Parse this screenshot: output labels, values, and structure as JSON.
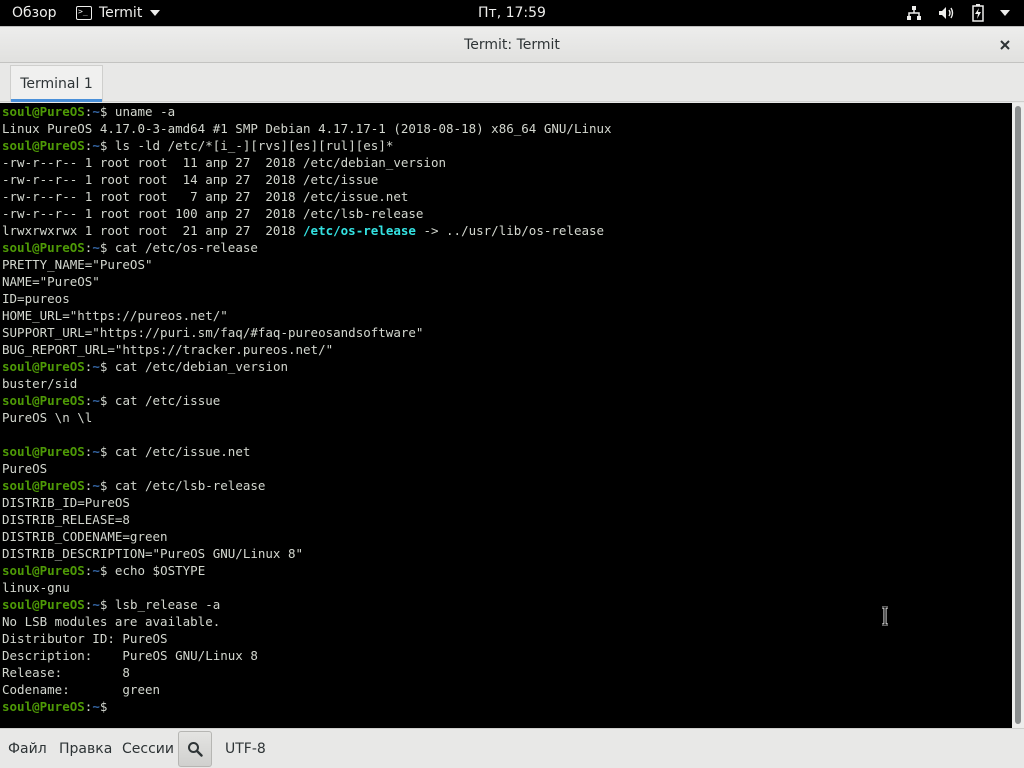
{
  "top_bar": {
    "activities": "Обзор",
    "app_menu": "Termit",
    "clock": "Пт, 17:59",
    "tray_icons": [
      "network-icon",
      "volume-icon",
      "battery-icon",
      "power-menu-icon"
    ]
  },
  "window": {
    "title": "Termit: Termit",
    "tabs": [
      {
        "label": "Terminal 1"
      }
    ]
  },
  "terminal": {
    "prompt_user": "soul@PureOS",
    "prompt_sep": ":",
    "prompt_path": "~",
    "prompt_dollar": "$",
    "lines": [
      {
        "type": "cmd",
        "text": " uname -a"
      },
      {
        "type": "out",
        "text": "Linux PureOS 4.17.0-3-amd64 #1 SMP Debian 4.17.17-1 (2018-08-18) x86_64 GNU/Linux"
      },
      {
        "type": "cmd",
        "text": " ls -ld /etc/*[i_-][rvs][es][rul][es]*"
      },
      {
        "type": "out",
        "text": "-rw-r--r-- 1 root root  11 апр 27  2018 /etc/debian_version"
      },
      {
        "type": "out",
        "text": "-rw-r--r-- 1 root root  14 апр 27  2018 /etc/issue"
      },
      {
        "type": "out",
        "text": "-rw-r--r-- 1 root root   7 апр 27  2018 /etc/issue.net"
      },
      {
        "type": "out",
        "text": "-rw-r--r-- 1 root root 100 апр 27  2018 /etc/lsb-release"
      },
      {
        "type": "link",
        "prefix": "lrwxrwxrwx 1 root root  21 апр 27  2018 ",
        "link": "/etc/os-release",
        "suffix": " -> ../usr/lib/os-release"
      },
      {
        "type": "cmd",
        "text": " cat /etc/os-release"
      },
      {
        "type": "out",
        "text": "PRETTY_NAME=\"PureOS\""
      },
      {
        "type": "out",
        "text": "NAME=\"PureOS\""
      },
      {
        "type": "out",
        "text": "ID=pureos"
      },
      {
        "type": "out",
        "text": "HOME_URL=\"https://pureos.net/\""
      },
      {
        "type": "out",
        "text": "SUPPORT_URL=\"https://puri.sm/faq/#faq-pureosandsoftware\""
      },
      {
        "type": "out",
        "text": "BUG_REPORT_URL=\"https://tracker.pureos.net/\""
      },
      {
        "type": "cmd",
        "text": " cat /etc/debian_version"
      },
      {
        "type": "out",
        "text": "buster/sid"
      },
      {
        "type": "cmd",
        "text": " cat /etc/issue"
      },
      {
        "type": "out",
        "text": "PureOS \\n \\l"
      },
      {
        "type": "out",
        "text": ""
      },
      {
        "type": "cmd",
        "text": " cat /etc/issue.net"
      },
      {
        "type": "out",
        "text": "PureOS"
      },
      {
        "type": "cmd",
        "text": " cat /etc/lsb-release"
      },
      {
        "type": "out",
        "text": "DISTRIB_ID=PureOS"
      },
      {
        "type": "out",
        "text": "DISTRIB_RELEASE=8"
      },
      {
        "type": "out",
        "text": "DISTRIB_CODENAME=green"
      },
      {
        "type": "out",
        "text": "DISTRIB_DESCRIPTION=\"PureOS GNU/Linux 8\""
      },
      {
        "type": "cmd",
        "text": " echo $OSTYPE"
      },
      {
        "type": "out",
        "text": "linux-gnu"
      },
      {
        "type": "cmd",
        "text": " lsb_release -a"
      },
      {
        "type": "out",
        "text": "No LSB modules are available."
      },
      {
        "type": "out",
        "text": "Distributor ID:\tPureOS"
      },
      {
        "type": "out",
        "text": "Description:\tPureOS GNU/Linux 8"
      },
      {
        "type": "out",
        "text": "Release:\t8"
      },
      {
        "type": "out",
        "text": "Codename:\tgreen"
      },
      {
        "type": "cmd",
        "text": " "
      }
    ]
  },
  "bottom_bar": {
    "menu_file": "Файл",
    "menu_edit": "Правка",
    "menu_sessions": "Сессии",
    "search_icon": "search-icon",
    "encoding": "UTF-8"
  },
  "colors": {
    "prompt_user": "#4e9a06",
    "prompt_path": "#3465a4",
    "link": "#34e2e2",
    "terminal_bg": "#000000",
    "terminal_fg": "#d3d7cf"
  }
}
